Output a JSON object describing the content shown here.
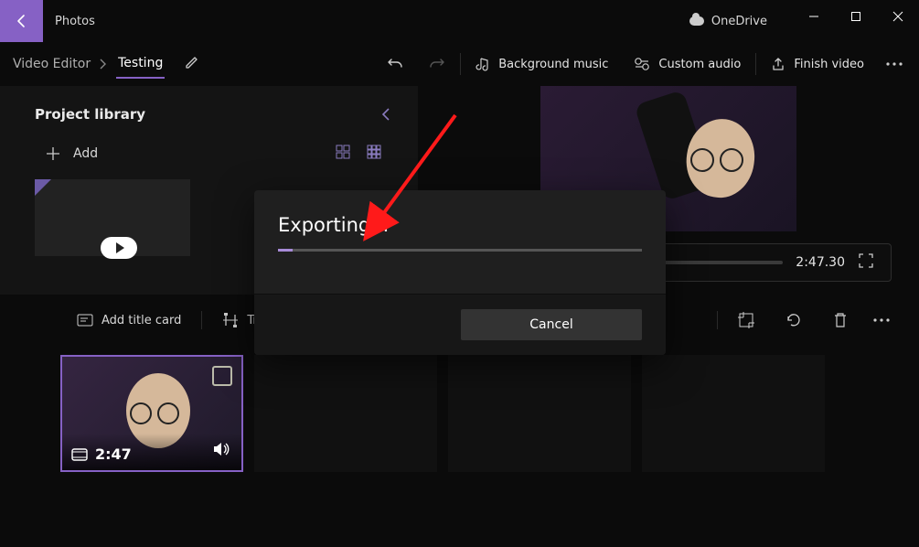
{
  "titlebar": {
    "app_name": "Photos",
    "onedrive_label": "OneDrive"
  },
  "toolbar": {
    "breadcrumb_root": "Video Editor",
    "breadcrumb_current": "Testing",
    "bg_music": "Background music",
    "custom_audio": "Custom audio",
    "finish_video": "Finish video"
  },
  "library": {
    "title": "Project library",
    "add_label": "Add"
  },
  "preview": {
    "timecode": "2:47.30"
  },
  "storybar": {
    "add_title_card": "Add title card",
    "trim": "Trim"
  },
  "clip": {
    "duration": "2:47"
  },
  "dialog": {
    "title": "Exporting...",
    "cancel": "Cancel"
  }
}
